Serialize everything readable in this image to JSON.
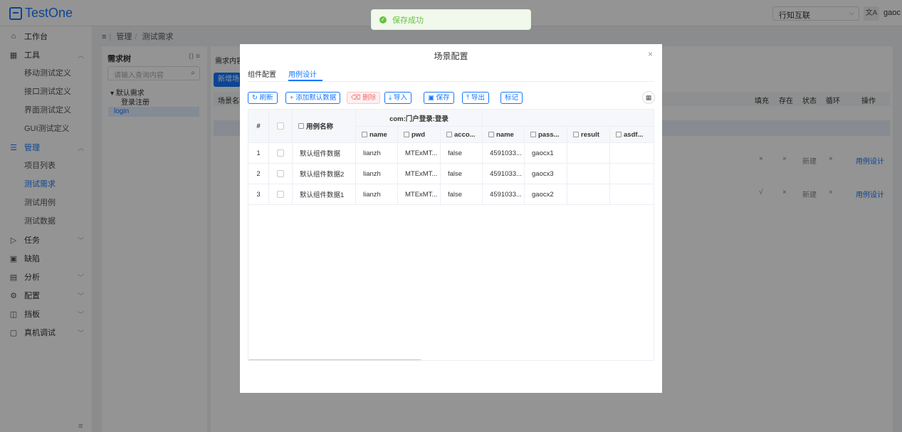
{
  "app": {
    "name": "TestOne"
  },
  "header": {
    "org": "行知互联",
    "lang": "文A",
    "user": "gaoc"
  },
  "sidebar": {
    "items": [
      {
        "label": "工作台",
        "icon": "home-icon"
      },
      {
        "label": "工具",
        "icon": "grid-icon"
      },
      {
        "label": "管理",
        "icon": "list-icon"
      },
      {
        "label": "任务",
        "icon": "play-icon"
      },
      {
        "label": "缺陷",
        "icon": "bug-icon"
      },
      {
        "label": "分析",
        "icon": "chart-icon"
      },
      {
        "label": "配置",
        "icon": "gear-icon"
      },
      {
        "label": "挡板",
        "icon": "panel-icon"
      },
      {
        "label": "真机调试",
        "icon": "device-icon"
      }
    ],
    "tools_sub": [
      "移动测试定义",
      "接口测试定义",
      "界面测试定义",
      "GUI测试定义"
    ],
    "manage_sub": [
      "项目列表",
      "测试需求",
      "测试用例",
      "测试数据"
    ]
  },
  "breadcrumb": [
    "管理",
    "测试需求"
  ],
  "tree": {
    "title": "需求树",
    "search_placeholder": "请输入查询内容",
    "root": "默认需求",
    "children": [
      "登录注册",
      "login"
    ]
  },
  "main": {
    "label": "需求内容",
    "new_btn": "新增场景",
    "headers": {
      "name": "场景名称",
      "fill": "填充",
      "exist": "存在",
      "status": "状态",
      "loop": "循环",
      "op": "操作"
    },
    "rows": [
      {
        "fill": "×",
        "exist": "×",
        "status": "新建",
        "loop": "×",
        "op": "用例设计"
      },
      {
        "fill": "√",
        "exist": "×",
        "status": "新建",
        "loop": "×",
        "op": "用例设计"
      }
    ]
  },
  "toast": {
    "message": "保存成功"
  },
  "modal": {
    "title": "场景配置",
    "tabs": [
      "组件配置",
      "用例设计"
    ],
    "toolbar": {
      "refresh": "刷新",
      "add_default": "添加默认数据",
      "delete": "删除",
      "import": "导入",
      "save": "保存",
      "export": "导出",
      "mark": "标记"
    },
    "table": {
      "col_index": "#",
      "col_case_name": "用例名称",
      "group_header": "com:门户登录:登录",
      "sub_headers": [
        "name",
        "pwd",
        "acco...",
        "name",
        "pass...",
        "result",
        "asdf..."
      ],
      "rows": [
        {
          "index": "1",
          "case_name": "默认组件数据",
          "values": [
            "lianzh",
            "MTExMT...",
            "false",
            "4591033...",
            "gaocx1",
            "",
            ""
          ]
        },
        {
          "index": "2",
          "case_name": "默认组件数据2",
          "values": [
            "lianzh",
            "MTExMT...",
            "false",
            "4591033...",
            "gaocx3",
            "",
            ""
          ]
        },
        {
          "index": "3",
          "case_name": "默认组件数据1",
          "values": [
            "lianzh",
            "MTExMT...",
            "false",
            "4591033...",
            "gaocx2",
            "",
            ""
          ]
        }
      ]
    }
  }
}
